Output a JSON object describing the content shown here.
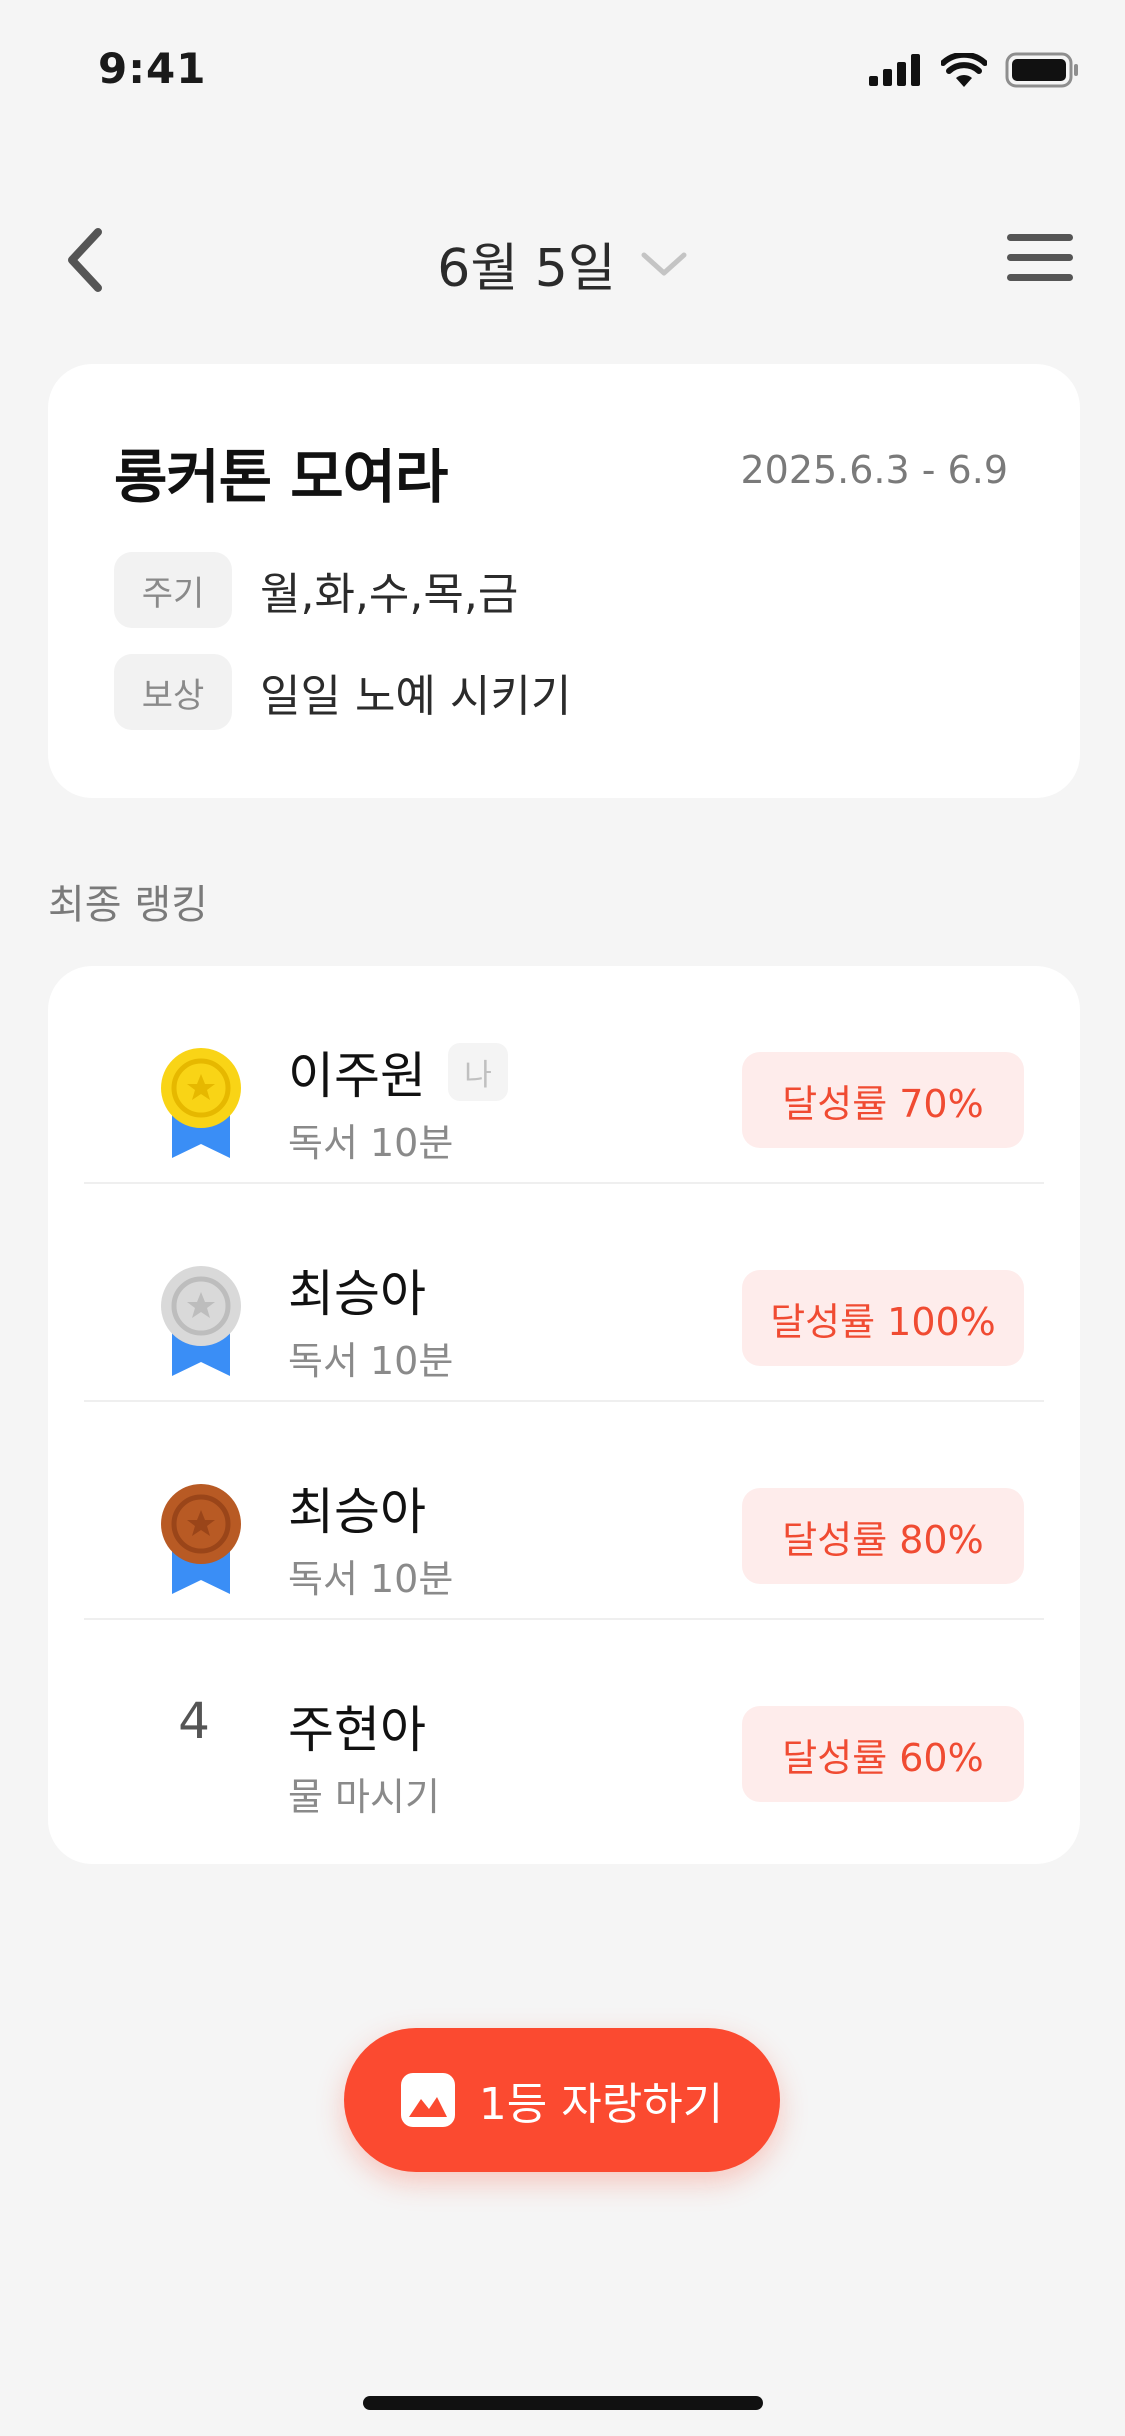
{
  "status_bar": {
    "time": "9:41"
  },
  "nav": {
    "title": "6월 5일"
  },
  "challenge": {
    "title": "롱커톤 모여라",
    "period": "2025.6.3 - 6.9",
    "cycle_label": "주기",
    "cycle_value": "월,화,수,목,금",
    "reward_label": "보상",
    "reward_value": "일일 노예 시키기"
  },
  "ranking": {
    "section_title": "최종 랭킹",
    "me_label": "나",
    "rows": [
      {
        "rank": "1",
        "medal": "gold-medal-icon",
        "name": "이주원",
        "habit": "독서 10분",
        "rate": "달성률 70%",
        "is_me": true
      },
      {
        "rank": "2",
        "medal": "silver-medal-icon",
        "name": "최승아",
        "habit": "독서 10분",
        "rate": "달성률 100%",
        "is_me": false
      },
      {
        "rank": "3",
        "medal": "bronze-medal-icon",
        "name": "최승아",
        "habit": "독서 10분",
        "rate": "달성률 80%",
        "is_me": false
      },
      {
        "rank": "4",
        "medal": null,
        "name": "주현아",
        "habit": "물 마시기",
        "rate": "달성률 60%",
        "is_me": false
      }
    ]
  },
  "cta": {
    "label": "1등 자랑하기",
    "icon": "image-icon"
  },
  "colors": {
    "accent": "#fb4a30",
    "badge_bg": "#feeceb",
    "badge_text": "#f04b32",
    "gold": "#f9d416",
    "silver": "#d9d9d9",
    "bronze": "#b85a24",
    "ribbon": "#3a8ef6"
  }
}
